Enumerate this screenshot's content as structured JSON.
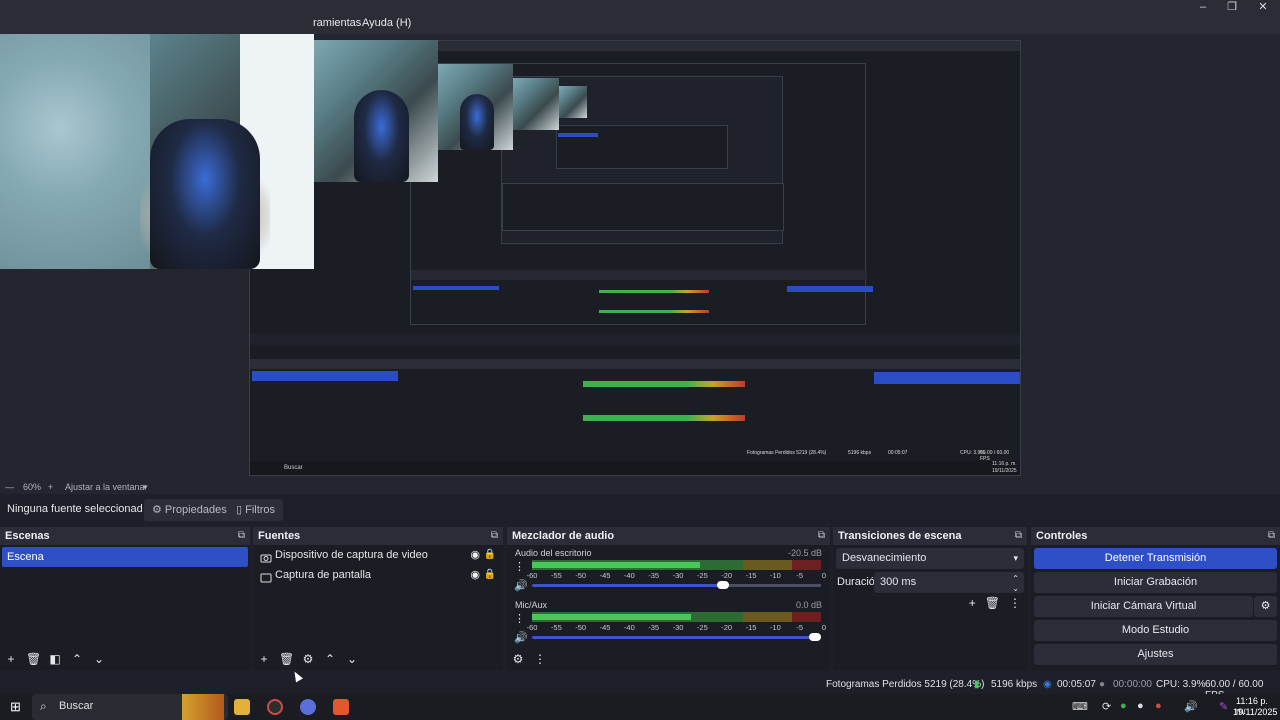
{
  "menu": {
    "tools": "ramientas",
    "help": "Ayuda (H)"
  },
  "window_controls": {
    "minimize": "–",
    "maximize": "❐",
    "close": "✕"
  },
  "preview": {
    "zoom": "60%",
    "fit_label": "Ajustar a la ventana",
    "nested_status_fps": "60.00 / 60.00 FPS",
    "nested_status_cpu": "CPU: 3.9%",
    "nested_status_dropped": "Fotogramas Perdidos 5219 (28.4%)",
    "nested_status_kbps": "5196 kbps",
    "nested_status_time": "00:05:07",
    "nested_time": "11:16 p. m.",
    "nested_date": "19/11/2025",
    "nested_search": "Buscar"
  },
  "source_bar": {
    "no_source": "Ninguna fuente seleccionad",
    "properties": "Propiedades",
    "filters": "Filtros"
  },
  "scenes": {
    "title": "Escenas",
    "items": [
      "Escena"
    ]
  },
  "sources": {
    "title": "Fuentes",
    "items": [
      {
        "label": "Dispositivo de captura de video",
        "icon": "camera-icon"
      },
      {
        "label": "Captura de pantalla",
        "icon": "monitor-icon"
      }
    ]
  },
  "mixer": {
    "title": "Mezclador de audio",
    "ticks": [
      "-60",
      "-55",
      "-50",
      "-45",
      "-40",
      "-35",
      "-30",
      "-25",
      "-20",
      "-15",
      "-10",
      "-5",
      "0"
    ],
    "channels": [
      {
        "name": "Audio del escritorio",
        "db": "-20.5 dB",
        "level": 0.58,
        "volume": 0.68
      },
      {
        "name": "Mic/Aux",
        "db": "0.0 dB",
        "level": 0.55,
        "volume": 1.0
      }
    ]
  },
  "transitions": {
    "title": "Transiciones de escena",
    "type": "Desvanecimiento",
    "duration_label": "Duración",
    "duration_value": "300 ms"
  },
  "controls": {
    "title": "Controles",
    "stop_stream": "Detener Transmisión",
    "start_record": "Iniciar Grabación",
    "start_vcam": "Iniciar Cámara Virtual",
    "studio_mode": "Modo Estudio",
    "settings": "Ajustes"
  },
  "status": {
    "dropped": "Fotogramas Perdidos 5219 (28.4%)",
    "kbps": "5196 kbps",
    "stream_time": "00:05:07",
    "rec_time": "00:00:00",
    "cpu": "CPU: 3.9%",
    "fps": "60.00 / 60.00 FPS"
  },
  "taskbar": {
    "search": "Buscar",
    "time": "11:16 p. m.",
    "date": "19/11/2025"
  },
  "colors": {
    "accent": "#2f4fc7",
    "panel": "#1b1d24",
    "header": "#2a2c37",
    "meter_green": "#48c85a"
  }
}
